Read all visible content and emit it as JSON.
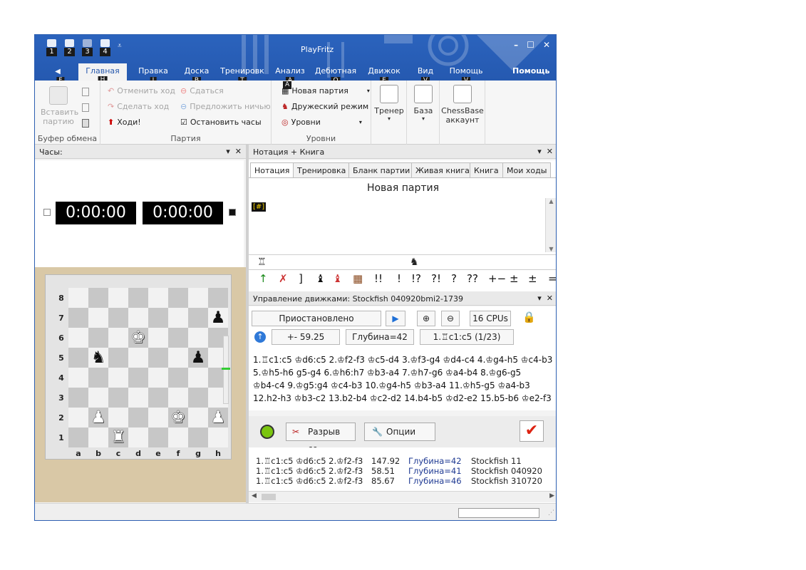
{
  "window": {
    "title": "PlayFritz",
    "minimize": "–",
    "maximize": "☐",
    "close": "✕"
  },
  "qat": [
    "1",
    "2",
    "3",
    "4"
  ],
  "qat_more": "⩡",
  "tabs": [
    {
      "label": "Главная",
      "key": "H"
    },
    {
      "label": "Правка",
      "key": "I"
    },
    {
      "label": "Доска",
      "key": "B"
    },
    {
      "label": "Тренировк",
      "key": "T"
    },
    {
      "label": "Анализ",
      "key": "A"
    },
    {
      "label": "Дебютная",
      "key": "O"
    },
    {
      "label": "Движок",
      "key": "E"
    },
    {
      "label": "Вид",
      "key": "V"
    },
    {
      "label": "Помощь",
      "key": "V"
    }
  ],
  "file_tab": "F",
  "help_right": "Помощь",
  "ribbon": {
    "clipboard": {
      "paste": "Вставить",
      "paste2": "партию",
      "group": "Буфер обмена"
    },
    "game": {
      "undo": "Отменить ход",
      "redo": "Сделать ход",
      "move": "Ходи!",
      "resign": "Сдаться",
      "offer_draw": "Предложить ничью",
      "stop_clock": "Остановить часы",
      "group": "Партия"
    },
    "levels": {
      "new_game": "Новая партия",
      "friendly": "Дружеский режим",
      "levels": "Уровни",
      "group": "Уровни"
    },
    "trainer": "Тренер",
    "base": "База",
    "account1": "ChessBase",
    "account2": "аккаунт"
  },
  "clock_panel": {
    "title": "Часы:",
    "white": "0:00:00",
    "black": "0:00:00"
  },
  "board": {
    "files": [
      "a",
      "b",
      "c",
      "d",
      "e",
      "f",
      "g",
      "h"
    ],
    "ranks": [
      "8",
      "7",
      "6",
      "5",
      "4",
      "3",
      "2",
      "1"
    ]
  },
  "notation": {
    "title": "Нотация + Книга",
    "tabs": [
      "Нотация",
      "Тренировка",
      "Бланк партии",
      "Живая книга",
      "Книга",
      "Мои ходы"
    ],
    "game_title": "Новая партия",
    "marker": "[#]"
  },
  "annotations": [
    "]",
    "!!",
    "!",
    "!?",
    "?!",
    "?",
    "??",
    "+−",
    "±",
    "±",
    "="
  ],
  "engine": {
    "title": "Управление движками: Stockfish 040920bmi2-1739",
    "status": "Приостановлено",
    "cpus": "16 CPUs",
    "eval": "+- 59.25",
    "depth": "Глубина=42",
    "current": "1.♖c1:c5 (1/23)",
    "lines": [
      "1.♖c1:c5 ♔d6:c5 2.♔f2-f3 ♔c5-d4 3.♔f3-g4 ♔d4-c4 4.♔g4-h5 ♔c4-b3",
      "5.♔h5-h6 g5-g4 6.♔h6:h7 ♔b3-a4 7.♔h7-g6 ♔a4-b4 8.♔g6-g5",
      "♔b4-c4 9.♔g5:g4 ♔c4-b3 10.♔g4-h5 ♔b3-a4 11.♔h5-g5 ♔a4-b3",
      "12.h2-h3 ♔b3-c2 13.b2-b4 ♔c2-d2 14.b4-b5 ♔d2-e2 15.b5-b6 ♔e2-f3"
    ]
  },
  "kibitzer": {
    "disconnect": "Разрыв со...",
    "options": "Опции",
    "rows": [
      {
        "line": "1.♖c1:c5 ♔d6:c5 2.♔f2-f3",
        "score": "147.92",
        "depth": "Глубина=42",
        "engine": "Stockfish 11"
      },
      {
        "line": "1.♖c1:c5 ♔d6:c5 2.♔f2-f3",
        "score": "58.51",
        "depth": "Глубина=41",
        "engine": "Stockfish 040920"
      },
      {
        "line": "1.♖c1:c5 ♔d6:c5 2.♔f2-f3",
        "score": "85.67",
        "depth": "Глубина=46",
        "engine": "Stockfish 310720"
      }
    ]
  },
  "colors": {
    "titlebar": "#2559b0",
    "accent": "#2859ad",
    "depth_text": "#1f3a93"
  }
}
